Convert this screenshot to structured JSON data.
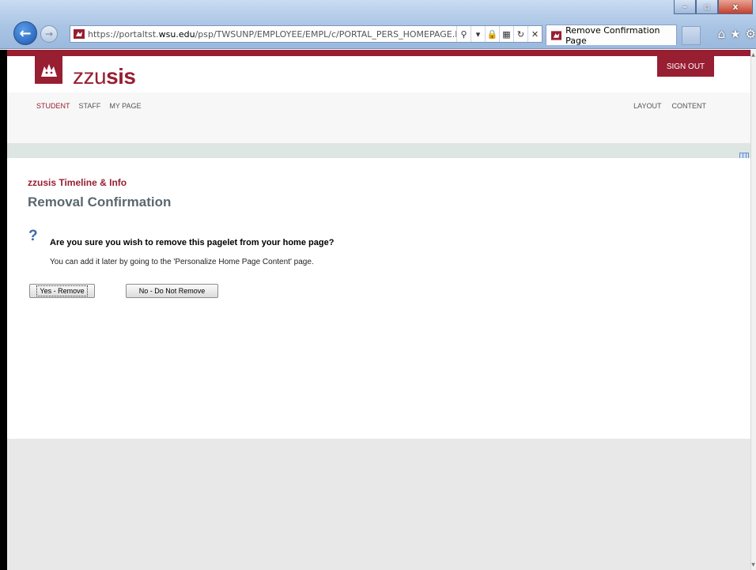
{
  "browser": {
    "url_prefix": "https://portaltst.",
    "url_host": "wsu.edu",
    "url_rest": "/psp/TWSUNP/EMPLOYEE/EMPL/c/PORTAL_PERS_HOMEPAGE.P(",
    "tab_title": "Remove Confirmation Page",
    "window_buttons": [
      "–",
      "▫",
      "x"
    ]
  },
  "header": {
    "brand_prefix": "zzu",
    "brand_suffix": "sis",
    "signout_label": "SIGN OUT"
  },
  "menu": {
    "left": [
      {
        "label": "STUDENT",
        "active": true
      },
      {
        "label": "STAFF",
        "active": false
      },
      {
        "label": "MY PAGE",
        "active": false
      }
    ],
    "right": [
      {
        "label": "LAYOUT"
      },
      {
        "label": "CONTENT"
      }
    ]
  },
  "content": {
    "subtitle": "zzusis Timeline & Info",
    "title": "Removal Confirmation",
    "question_mark": "?",
    "question": "Are you sure you wish to remove this pagelet from your home page?",
    "hint": "You can add it later by going to the 'Personalize Home Page Content' page.",
    "yes_label": "Yes - Remove",
    "no_label": "No - Do Not Remove"
  },
  "colors": {
    "brand_crimson": "#981e32",
    "nav_bar": "#f7f7f7",
    "divider_bar": "#dde6e3",
    "footer_gray": "#e8e8e8"
  }
}
